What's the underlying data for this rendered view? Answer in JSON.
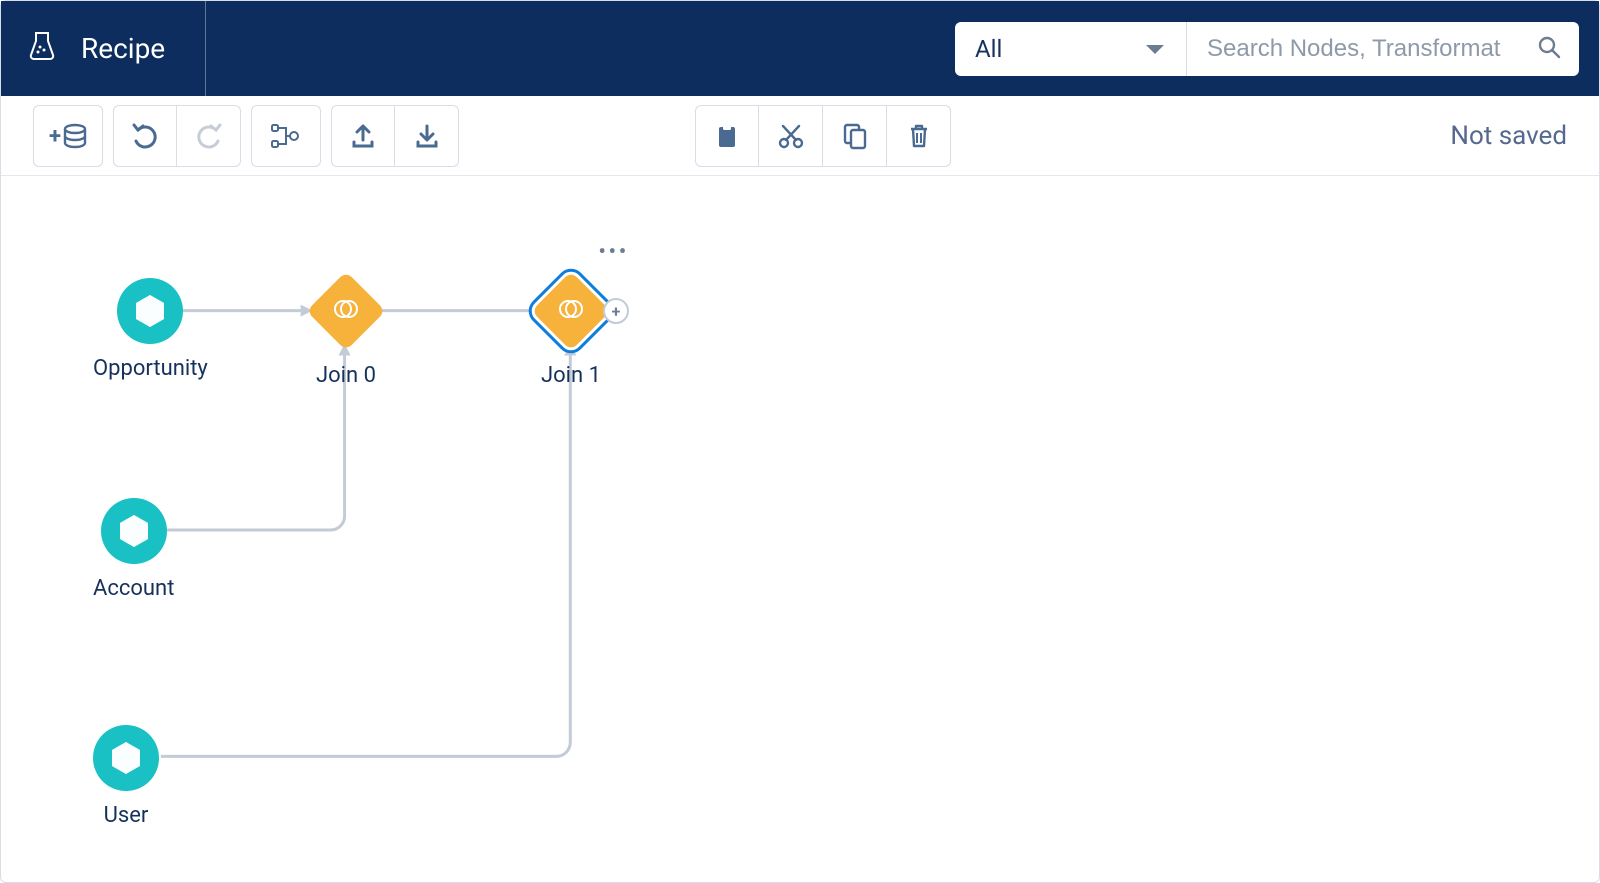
{
  "header": {
    "title": "Recipe",
    "filter_label": "All",
    "search_placeholder": "Search Nodes, Transformat"
  },
  "toolbar": {
    "add_input_tooltip": "Add Input",
    "undo_tooltip": "Undo",
    "redo_tooltip": "Redo",
    "layout_tooltip": "Layout",
    "upload_tooltip": "Upload",
    "download_tooltip": "Download",
    "paste_tooltip": "Paste",
    "cut_tooltip": "Cut",
    "copy_tooltip": "Copy",
    "delete_tooltip": "Delete",
    "save_state": "Not saved"
  },
  "nodes": {
    "opportunity": {
      "label": "Opportunity",
      "type": "input"
    },
    "account": {
      "label": "Account",
      "type": "input"
    },
    "user": {
      "label": "User",
      "type": "input"
    },
    "join0": {
      "label": "Join 0",
      "type": "join",
      "selected": false
    },
    "join1": {
      "label": "Join 1",
      "type": "join",
      "selected": true,
      "show_menu": true,
      "show_plus": true,
      "plus_glyph": "+"
    }
  },
  "edges": [
    {
      "from": "opportunity",
      "to": "join0"
    },
    {
      "from": "account",
      "to": "join0"
    },
    {
      "from": "join0",
      "to": "join1"
    },
    {
      "from": "user",
      "to": "join1"
    }
  ]
}
